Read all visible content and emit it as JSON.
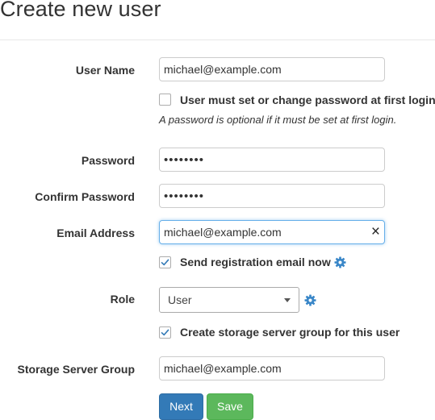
{
  "page": {
    "title": "Create new user"
  },
  "form": {
    "username": {
      "label": "User Name",
      "value": "michael@example.com"
    },
    "must_change_password": {
      "label": "User must set or change password at first login",
      "checked": false,
      "help": "A password is optional if it must be set at first login."
    },
    "password": {
      "label": "Password",
      "value": "••••••••"
    },
    "confirm_password": {
      "label": "Confirm Password",
      "value": "••••••••"
    },
    "email": {
      "label": "Email Address",
      "value": "michael@example.com",
      "clear_icon": "×"
    },
    "send_registration": {
      "label": "Send registration email now",
      "checked": true,
      "icon": "gear-icon"
    },
    "role": {
      "label": "Role",
      "value": "User",
      "icon": "gear-icon"
    },
    "create_storage_group": {
      "label": "Create storage server group for this user",
      "checked": true
    },
    "storage_server_group": {
      "label": "Storage Server Group",
      "value": "michael@example.com"
    }
  },
  "buttons": {
    "next": "Next",
    "save": "Save"
  },
  "colors": {
    "primary": "#337ab7",
    "success": "#5cb85c",
    "checkmark": "#337ab7",
    "gear": "#3a87c8"
  }
}
